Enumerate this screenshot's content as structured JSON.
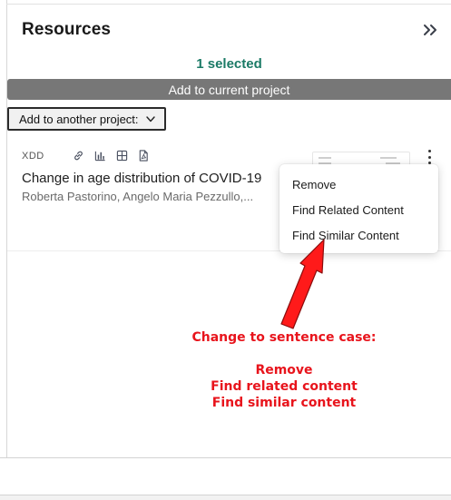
{
  "panel": {
    "title": "Resources",
    "selected_count": "1 selected",
    "add_current_label": "Add to current project",
    "add_another_label": "Add to another project:"
  },
  "resource": {
    "source": "XDD",
    "title": "Change in age distribution of COVID-19",
    "authors": "Roberta Pastorino, Angelo Maria Pezzullo,..."
  },
  "menu": {
    "items": [
      "Remove",
      "Find Related Content",
      "Find Similar Content"
    ]
  },
  "annotation": {
    "heading": "Change to sentence case:",
    "lines": [
      "Remove",
      "Find related content",
      "Find similar content"
    ]
  },
  "icons": {
    "collapse": "double-chevron-right-icon",
    "dropdown": "chevron-down-icon",
    "card_icons": [
      "link-icon",
      "bar-chart-icon",
      "table-icon",
      "pdf-file-icon"
    ],
    "kebab": "more-vertical-icon"
  },
  "colors": {
    "accent": "#1b7a66",
    "button_bg": "#777777",
    "annotation": "#e8141c"
  }
}
